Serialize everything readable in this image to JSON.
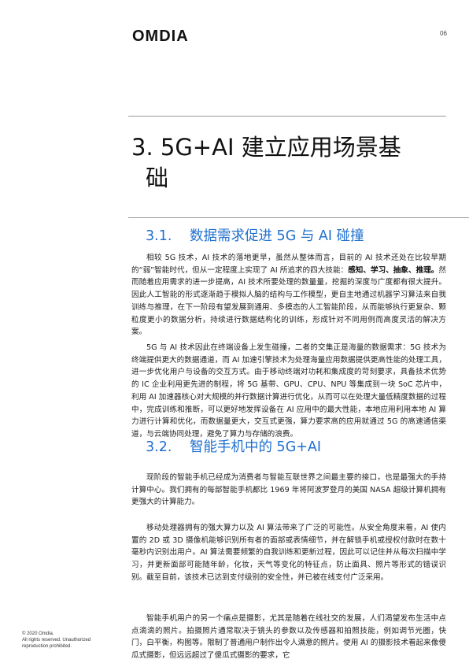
{
  "header": {
    "logo": "OMDIA",
    "page_number": "06"
  },
  "chapter": {
    "title_line1": "3. 5G+AI 建立应用场景基",
    "title_line2": "础"
  },
  "sections": [
    {
      "number": "3.1.",
      "title": "数据需求促进 5G 与 AI 碰撞",
      "paragraphs": [
        {
          "before": "相较 5G 技术，AI 技术的落地更早，虽然从整体而言，目前的 AI 技术还处在比较早期的“弱”智能时代，但从一定程度上实现了 AI 所追求的四大技能：",
          "bold": "感知、学习、抽象、推理。",
          "after": "然而随着应用需求的进一步提高，AI 技术所要处理的数量量，挖掘的深度与广度都有很大提升。因此人工智能的形式逐渐趋于模拟人脑的结构与工作模型，更自主地通过机器学习算法来自我训练与推理，在下一阶段有望发展到通用、多模态的人工智能阶段，从而能够执行更复杂、颗粒度更小的数据分析，持续进行数据结构化的训练，形成针对不同用例而高度灵活的解决方案。"
        },
        {
          "text": "5G 与 AI 技术因此在终端设备上发生碰撞，二者的交集正是海量的数据需求：5G 技术为终端提供更大的数据通道，而 AI 加速引擎技术为处理海量应用数据提供更高性能的处理工具，进一步优化用户与设备的交互方式。由于移动终端对功耗和集成度的苛刻要求，具备技术优势的 IC 企业利用更先进的制程，将 5G 基带、GPU、CPU、NPU 等集成到一块 SoC 芯片中，利用 AI 加速器核心对大规模的并行数据计算进行优化，从而可以在处理大量低精度数据的过程中，完成训练和推断，可以更好地发挥设备在 AI 应用中的最大性能，本地应用利用本地 AI 算力进行计算和优化，而数据量更大，交互式更强，算力要求高的应用就通过 5G 的高速通信渠道，与云端协同处理，避免了算力与存储的浪费。"
        }
      ]
    },
    {
      "number": "3.2.",
      "title": "智能手机中的 5G+AI",
      "paragraphs": [
        {
          "text": "现阶段的智能手机已经成为消费者与智能互联世界之间最主要的接口，也是最强大的手持计算中心。我们拥有的每部智能手机都比 1969 年将阿波罗登月的美国 NASA 超级计算机拥有更强大的计算能力。"
        },
        {
          "text": "移动处理器拥有的强大算力以及 AI 算法带来了广泛的可能性。从安全角度来看，AI 使内置的 2D 或 3D 摄像机能够识别所有者的面部或表情细节，并在解锁手机或授权付款时在数十毫秒内识别出用户。AI 算法需要频繁的自我训练和更新过程，因此可以记住并从每次扫描中学习，并更新面部可能随年龄，化妆，天气等变化的特征点，防止面具、照片等形式的错误识别。截至目前，该技术已达到支付级别的安全性，并已被在线支付广泛采用。"
        },
        {
          "text": "智能手机用户的另一个痛点是摄影，尤其是随着在线社交的发展，人们渴望发布生活中点点滴滴的照片。拍摄照片通常取决于镜头的参数以及传感器和拍照技能，例如调节光圈，快门，白平衡，构图等。限制了普通用户制作出令人满意的照片。使用 AI 的摄影技术看起来像傻瓜式摄影，但远远超过了傻瓜式摄影的要求，它"
        }
      ]
    }
  ],
  "footer": {
    "copyright": "© 2020 Omdia.",
    "rights_line1": "All rights reserved. Unauthorized",
    "rights_line2": "reproduction prohibited."
  }
}
